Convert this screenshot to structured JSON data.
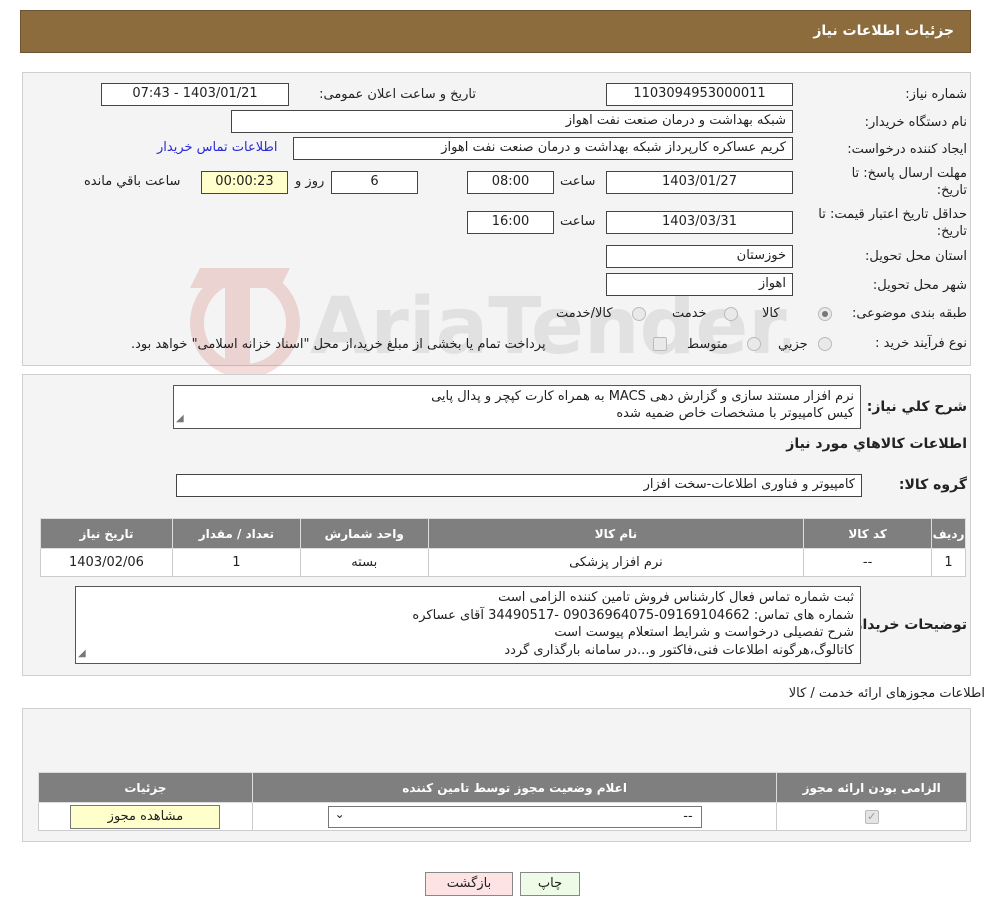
{
  "header": {
    "title": "جزئیات اطلاعات نیاز"
  },
  "watermark": {
    "text": "AriaTender.neT"
  },
  "info": {
    "need_number_label": "شماره نیاز:",
    "need_number": "1103094953000011",
    "announce_label": "تاریخ و ساعت اعلان عمومی:",
    "announce_value": "1403/01/21 - 07:43",
    "buyer_org_label": "نام دستگاه خریدار:",
    "buyer_org": "شبکه بهداشت و درمان صنعت نفت اهواز",
    "creator_label": "ایجاد کننده درخواست:",
    "creator": "کریم عساکره کارپرداز شبکه بهداشت و درمان صنعت نفت اهواز",
    "contact_link": "اطلاعات تماس خریدار",
    "deadline_label": "مهلت ارسال پاسخ: تا تاریخ:",
    "deadline_date": "1403/01/27",
    "time_label": "ساعت",
    "deadline_time": "08:00",
    "days_value": "6",
    "days_label": "روز و",
    "remaining_time": "00:00:23",
    "remaining_label": "ساعت باقي مانده",
    "validity_label": "حداقل تاریخ اعتبار قیمت: تا تاریخ:",
    "validity_date": "1403/03/31",
    "validity_time": "16:00",
    "province_label": "استان محل تحویل:",
    "province": "خوزستان",
    "city_label": "شهر محل تحویل:",
    "city": "اهواز",
    "category_label": "طبقه بندی موضوعی:",
    "category_options": [
      "کالا",
      "خدمت",
      "کالا/خدمت"
    ],
    "process_label": "نوع فرآیند خرید :",
    "process_options": [
      "جزيي",
      "متوسط"
    ],
    "process_note": "پرداخت تمام یا بخشی از مبلغ خرید،از محل \"اسناد خزانه اسلامی\" خواهد بود."
  },
  "description": {
    "label": "شرح كلي نياز:",
    "line1": "نرم افزار مستند سازی و  گزارش دهی MACS  به همراه کارت کپچر و پدال پایی",
    "line2": "کیس کامپیوتر با مشخصات خاص ضمیه شده",
    "goods_title": "اطلاعات كالاهاي مورد نياز",
    "group_label": "گروه کالا:",
    "group_value": "کامپیوتر و فناوری اطلاعات-سخت افزار"
  },
  "goods_table": {
    "headers": [
      "رديف",
      "کد کالا",
      "نام کالا",
      "واحد شمارش",
      "تعداد / مقدار",
      "تاریخ نیاز"
    ],
    "rows": [
      [
        "1",
        "--",
        "نرم افزار پزشکی",
        "بسته",
        "1",
        "1403/02/06"
      ]
    ]
  },
  "buyer_notes": {
    "label": "توضیحات خریدار:",
    "lines": [
      "ثبت شماره تماس فعال کارشناس فروش تامین کننده الزامی است",
      "شماره های تماس: 09169104662-09036964075 -34490517 آقای عساکره",
      "شرح تفصیلی درخواست و شرایط استعلام پیوست است",
      "کاتالوگ،هرگونه اطلاعات فنی،فاکتور و...در سامانه بارگذاری گردد"
    ]
  },
  "permits": {
    "title": "اطلاعات مجوزهای ارائه خدمت / کالا",
    "headers": [
      "الزامی بودن ارائه مجوز",
      "اعلام وضعیت مجوز توسط تامین کننده",
      "جزئیات"
    ],
    "select_value": "--",
    "view_button": "مشاهده مجوز"
  },
  "actions": {
    "print": "چاپ",
    "back": "بازگشت"
  }
}
